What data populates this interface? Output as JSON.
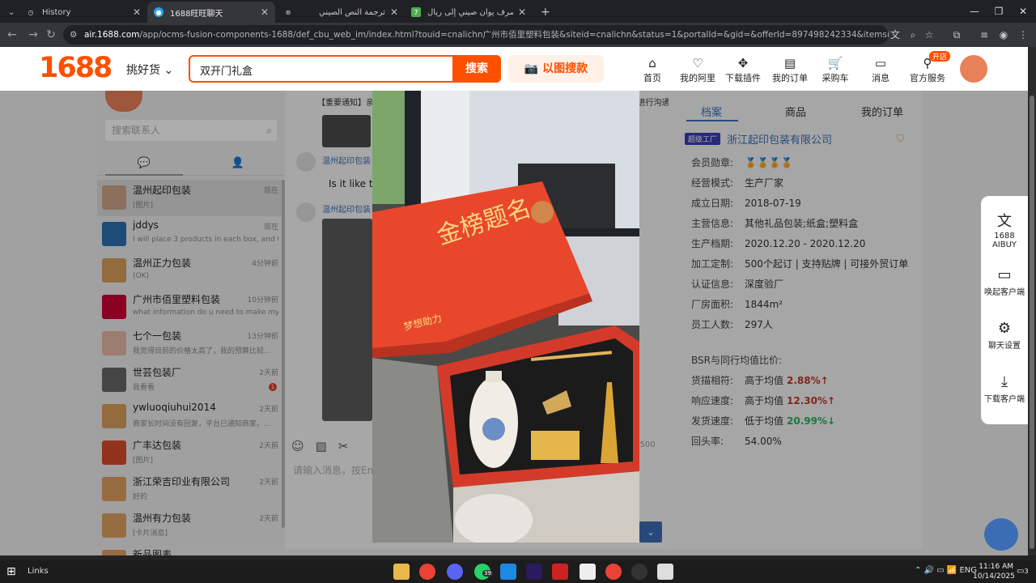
{
  "browser": {
    "tabs": [
      {
        "title": "History",
        "active": false
      },
      {
        "title": "1688旺旺聊天",
        "active": true
      },
      {
        "title": "ترجمة النص الصيني",
        "active": false
      },
      {
        "title": "سعر صرف يوان صيني إلى ريال",
        "active": false
      }
    ],
    "url_site": "air.1688.com",
    "url_rest": "/app/ocms-fusion-components-1688/def_cbu_web_im/index.html?touid=cnalichn广州市佰里塑料包装&siteid=cnalichn&status=1&portalId=&gid=&offerId=897498242334&itemsId=&spm=a261y.7663282.widgets.i0.4bc82f9..."
  },
  "header": {
    "logo": "1688",
    "pick_goods": "挑好货",
    "search_value": "双开门礼盒",
    "search_button": "搜索",
    "image_search": "以图搜款",
    "nav": [
      {
        "label": "首页",
        "icon": "home-icon"
      },
      {
        "label": "我的阿里",
        "icon": "heart-icon"
      },
      {
        "label": "下载插件",
        "icon": "puzzle-icon"
      },
      {
        "label": "我的订单",
        "icon": "clipboard-icon"
      },
      {
        "label": "采购车",
        "icon": "cart-icon"
      },
      {
        "label": "消息",
        "icon": "message-icon"
      },
      {
        "label": "官方服务",
        "icon": "person-icon"
      }
    ],
    "service_badge": "开店"
  },
  "chat": {
    "contact_search_placeholder": "搜索联系人",
    "contacts": [
      {
        "name": "温州起印包装",
        "time": "现在",
        "preview": "[图片]"
      },
      {
        "name": "jddys",
        "time": "现在",
        "preview": "I will place 3 products in each box, and the pr..."
      },
      {
        "name": "温州正力包装",
        "time": "4分钟前",
        "preview": "(OK)"
      },
      {
        "name": "广州市佰里塑料包装",
        "time": "10分钟前",
        "preview": "what information do u need to make my box?"
      },
      {
        "name": "七个一包装",
        "time": "13分钟前",
        "preview": "我觉得目前的价格太高了，我的预算比较..."
      },
      {
        "name": "世芸包装厂",
        "time": "2天前",
        "preview": "我看看",
        "badge": "1"
      },
      {
        "name": "ywluoqiuhui2014",
        "time": "2天前",
        "preview": "商家长时间没有回复，平台已通知商家。..."
      },
      {
        "name": "广丰达包装",
        "time": "2天前",
        "preview": "[图片]"
      },
      {
        "name": "浙江荣吉印业有限公司",
        "time": "2天前",
        "preview": "好的"
      },
      {
        "name": "温州有力包装",
        "time": "2天前",
        "preview": "[卡片消息]"
      },
      {
        "name": "新品图表",
        "time": "",
        "preview": ""
      }
    ],
    "notice": "【重要通知】亲爱的用户，为了提升您的询盘的效率，千牛旺旺将逐步不支持与1688商家进行沟通，若您想要使用客户端进行沟通，可点击右侧下载1688客户端",
    "messages": [
      {
        "sender": "温州起印包装",
        "text": "Is it like thi"
      },
      {
        "sender": "温州起印包装",
        "text": ""
      }
    ],
    "input_placeholder": "请输入消息，按Enter",
    "char_count": "/ 500"
  },
  "profile": {
    "tabs": [
      "档案",
      "商品",
      "我的订单"
    ],
    "tag": "超级工厂",
    "company": "浙江起印包装有限公司",
    "rows": [
      {
        "label": "会员勋章:",
        "value": "🏅🏅🏅🏅"
      },
      {
        "label": "经营模式:",
        "value": "生产厂家"
      },
      {
        "label": "成立日期:",
        "value": "2018-07-19"
      },
      {
        "label": "主营信息:",
        "value": "其他礼品包装;纸盒;塑料盒"
      },
      {
        "label": "生产档期:",
        "value": "2020.12.20 - 2020.12.20"
      },
      {
        "label": "加工定制:",
        "value": "500个起订 | 支持贴牌 | 可接外贸订单"
      },
      {
        "label": "认证信息:",
        "value": "深度验厂"
      },
      {
        "label": "厂房面积:",
        "value": "1844m²"
      },
      {
        "label": "员工人数:",
        "value": "297人"
      }
    ],
    "bsr_title": "BSR与同行均值比价:",
    "bsr": [
      {
        "label": "货描相符:",
        "text": "高于均值",
        "pct": "2.88%",
        "arrow": "↑",
        "dir": "up"
      },
      {
        "label": "响应速度:",
        "text": "高于均值",
        "pct": "12.30%",
        "arrow": "↑",
        "dir": "up"
      },
      {
        "label": "发货速度:",
        "text": "低于均值",
        "pct": "20.99%",
        "arrow": "↓",
        "dir": "down"
      }
    ],
    "repeat_label": "回头率:",
    "repeat_value": "54.00%"
  },
  "float_panel": [
    {
      "label": "1688 AIBUY",
      "icon": "translate-icon"
    },
    {
      "label": "唤起客户端",
      "icon": "monitor-icon"
    },
    {
      "label": "聊天设置",
      "icon": "settings-icon"
    },
    {
      "label": "下载客户端",
      "icon": "download-icon"
    }
  ],
  "viewer_image_text": {
    "card_title": "金榜题名",
    "card_stamp": "梦想助力"
  },
  "taskbar": {
    "links": "Links",
    "tray": "ENG",
    "time": "11:16 AM",
    "date": "10/14/2025",
    "notif": "3",
    "whatsapp_badge": "39"
  },
  "colors": {
    "brand": "#ff5000",
    "link": "#3b6db5",
    "up": "#c0392b",
    "down": "#27ae60"
  }
}
